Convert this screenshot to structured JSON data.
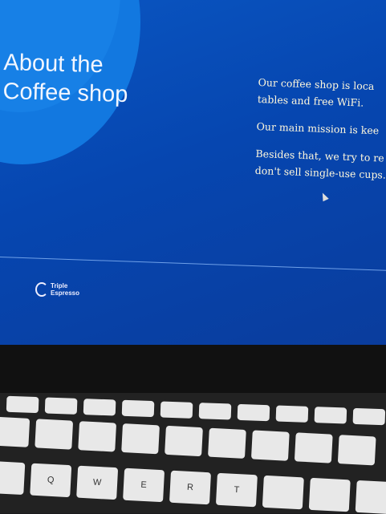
{
  "page": {
    "title_line1": "About the",
    "title_line2": "Coffee shop",
    "paragraphs": [
      {
        "line1": "Our coffee shop is loca",
        "line2": "tables and free WiFi."
      },
      {
        "line1": "Our main mission is kee",
        "line2": ""
      },
      {
        "line1": "Besides that, we try to re",
        "line2": "don't sell single-use cups."
      }
    ],
    "logo": {
      "line1": "Triple",
      "line2": "Espresso"
    }
  },
  "keyboard": {
    "letters": [
      "Q",
      "W",
      "E",
      "R",
      "T"
    ]
  },
  "colors": {
    "background": "#0646b0",
    "circle": "#1278e0",
    "text": "#fff8dc"
  }
}
